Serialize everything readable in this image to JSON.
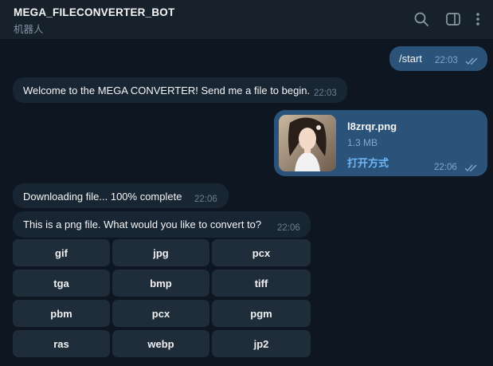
{
  "header": {
    "title": "MEGA_FILECONVERTER_BOT",
    "subtitle": "机器人",
    "icons": [
      "search-icon",
      "sidebar-toggle-icon",
      "more-vert-icon"
    ]
  },
  "colors": {
    "background": "#0e1621",
    "header": "#17212b",
    "outgoing_bubble": "#2b5278",
    "incoming_bubble": "#182533",
    "keyboard_button": "#1f2c3a",
    "accent_link": "#6cb6f5"
  },
  "messages": {
    "start": {
      "text": "/start",
      "time": "22:03"
    },
    "welcome": {
      "text": "Welcome to the MEGA CONVERTER! Send me a file to begin.",
      "time": "22:03"
    },
    "file": {
      "name": "l8zrqr.png",
      "size": "1.3 MB",
      "action": "打开方式",
      "time": "22:06"
    },
    "downloading": {
      "text": "Downloading file... 100% complete",
      "time": "22:06"
    },
    "prompt": {
      "text": "This is a png file. What would you like to convert to?",
      "time": "22:06"
    }
  },
  "keyboard": [
    [
      "gif",
      "jpg",
      "pcx"
    ],
    [
      "tga",
      "bmp",
      "tiff"
    ],
    [
      "pbm",
      "pcx",
      "pgm"
    ],
    [
      "ras",
      "webp",
      "jp2"
    ]
  ]
}
